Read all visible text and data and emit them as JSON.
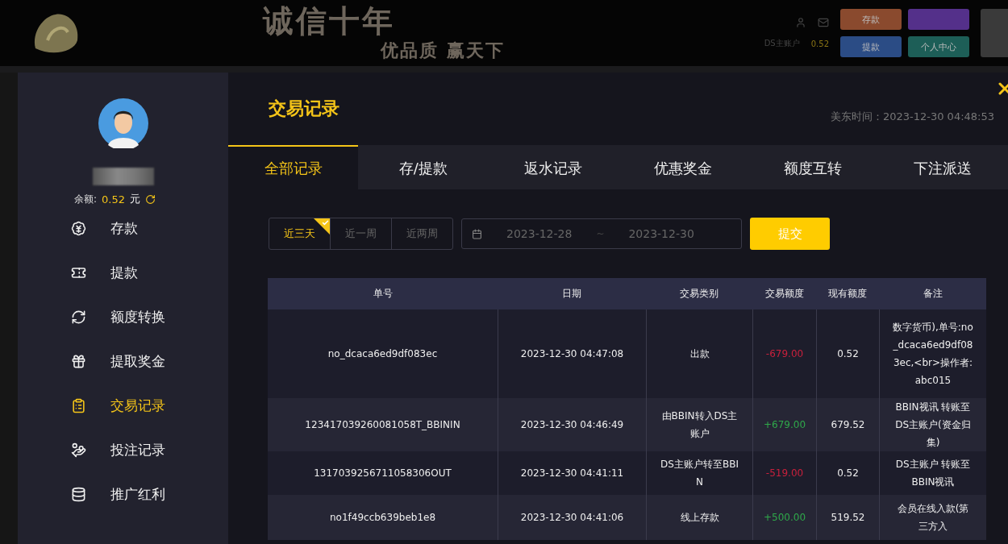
{
  "header": {
    "slogan": "诚信十年",
    "tagline": "优品质  赢天下",
    "account_label": "DS主账户",
    "account_balance": "0.52",
    "buttons": [
      {
        "label": "存款",
        "color": "#8a4a2e"
      },
      {
        "color": "#54308a"
      },
      {
        "label": "提款",
        "color": "#2b4c85"
      },
      {
        "label": "个人中心",
        "color": "#1d5e57"
      }
    ]
  },
  "sidebar": {
    "balance_label": "余额:",
    "balance": "0.52",
    "currency": "元",
    "items": [
      {
        "label": "存款",
        "selected": false
      },
      {
        "label": "提款",
        "selected": false
      },
      {
        "label": "额度转换",
        "selected": false
      },
      {
        "label": "提取奖金",
        "selected": false
      },
      {
        "label": "交易记录",
        "selected": true
      },
      {
        "label": "投注记录",
        "selected": false
      },
      {
        "label": "推广红利",
        "selected": false
      }
    ]
  },
  "main": {
    "title": "交易记录",
    "time": "美东时间：2023-12-30 04:48:53",
    "tabs": [
      {
        "label": "全部记录",
        "selected": true
      },
      {
        "label": "存/提款",
        "selected": false
      },
      {
        "label": "返水记录",
        "selected": false
      },
      {
        "label": "优惠奖金",
        "selected": false
      },
      {
        "label": "额度互转",
        "selected": false
      },
      {
        "label": "下注派送",
        "selected": false
      }
    ],
    "ranges": [
      {
        "label": "近三天",
        "selected": true
      },
      {
        "label": "近一周",
        "selected": false
      },
      {
        "label": "近两周",
        "selected": false
      }
    ],
    "date_from": "2023-12-28",
    "date_separator": "~",
    "date_to": "2023-12-30",
    "submit": "提交",
    "table": {
      "columns": [
        "单号",
        "日期",
        "交易类别",
        "交易额度",
        "现有额度",
        "备注"
      ],
      "rows": [
        {
          "id": "no_dcaca6ed9df083ec",
          "date": "2023-12-30 04:47:08",
          "type": "出款",
          "amount": "-679.00",
          "kind": "debit",
          "balance": "0.52",
          "note": "数字货币),单号:no_dcaca6ed9df083ec,<br>操作者:abc015"
        },
        {
          "id": "123417039260081058T_BBININ",
          "date": "2023-12-30 04:46:49",
          "type": "由BBIN转入DS主账户",
          "amount": "+679.00",
          "kind": "credit",
          "balance": "679.52",
          "note": "BBIN视讯 转账至 DS主账户(资金归集)"
        },
        {
          "id": "1317039256711058306OUT",
          "date": "2023-12-30 04:41:11",
          "type": "DS主账户转至BBIN",
          "amount": "-519.00",
          "kind": "debit",
          "balance": "0.52",
          "note": "DS主账户 转账至 BBIN视讯"
        },
        {
          "id": "no1f49ccb639beb1e8",
          "date": "2023-12-30 04:41:06",
          "type": "线上存款",
          "amount": "+500.00",
          "kind": "credit",
          "balance": "519.52",
          "note": "会员在线入款(第三方入"
        }
      ]
    }
  }
}
